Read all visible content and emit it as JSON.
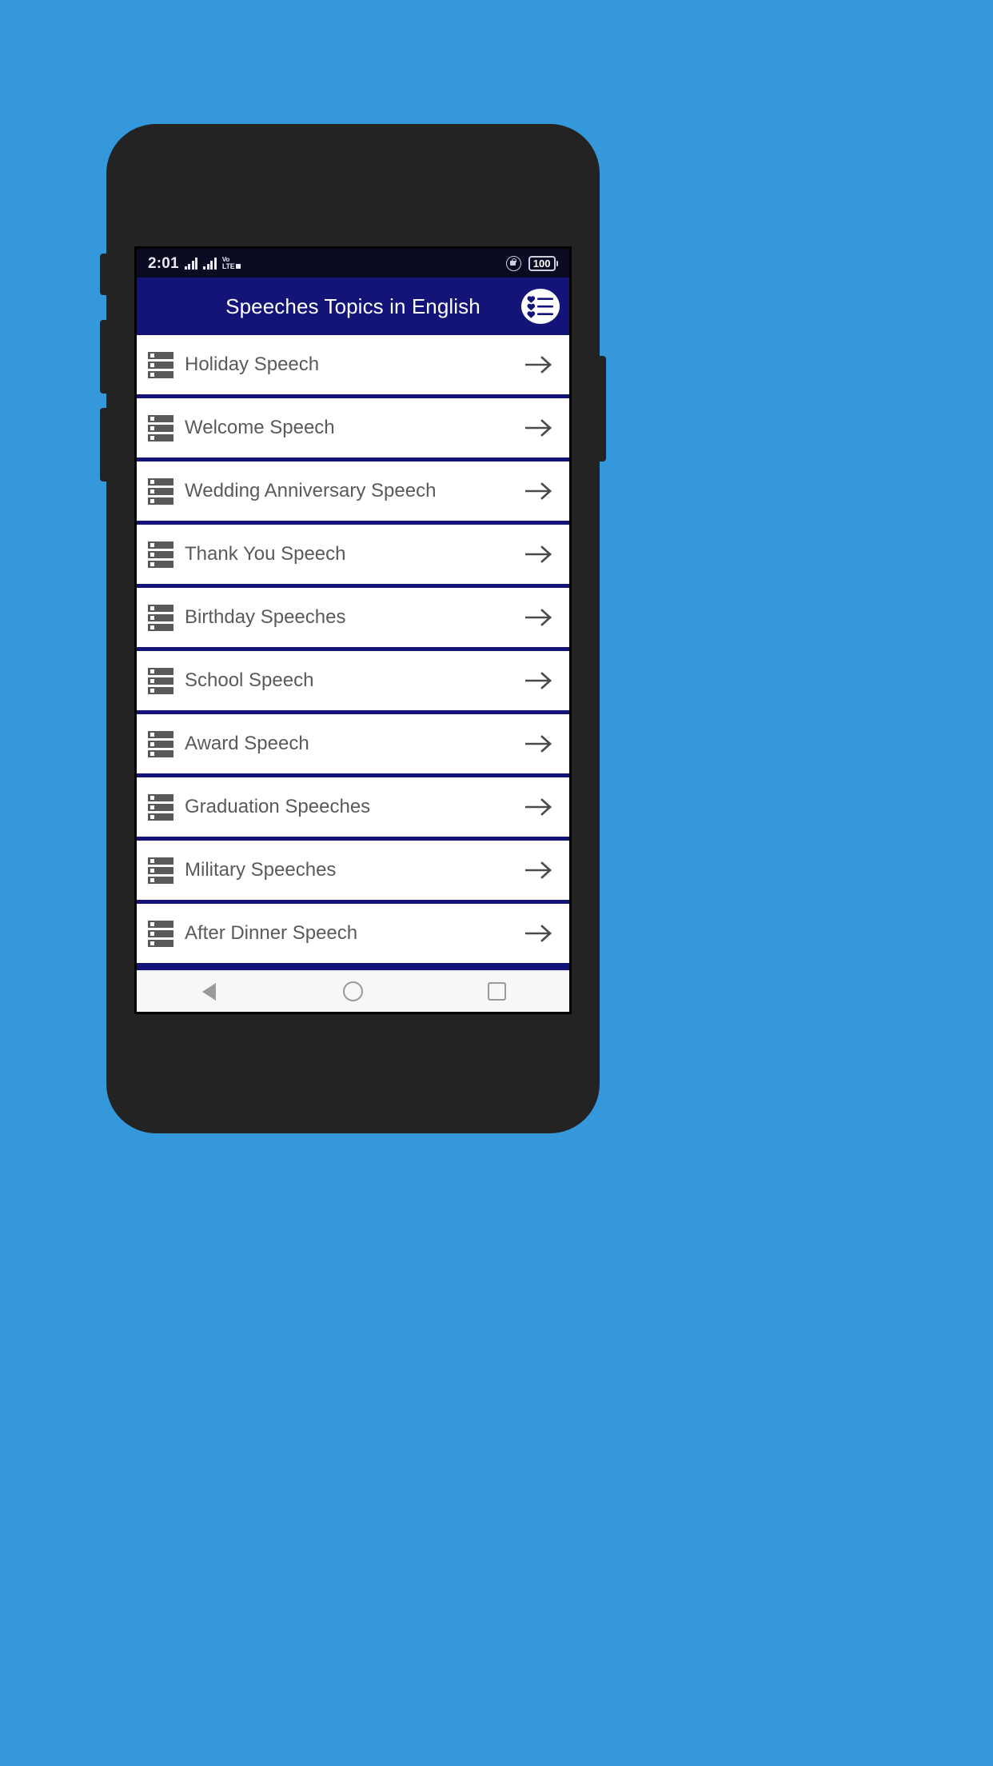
{
  "background_color": "#3498db",
  "device": {
    "frame_color": "#232323",
    "buttons": [
      "volume-up",
      "volume-down",
      "power",
      "side-button-right"
    ]
  },
  "status_bar": {
    "time": "2:01",
    "network_label_top": "Vo",
    "network_label_bottom": "LTE",
    "signal_icon": "signal-bars-icon",
    "rotation_lock_icon": "rotation-lock-icon",
    "battery_level": "100",
    "background_color": "#0a0a22"
  },
  "app_bar": {
    "title": "Speeches Topics in English",
    "background_color": "#141478",
    "action_icon": "favorites-list-icon"
  },
  "list": {
    "divider_color": "#141478",
    "row_icon": "list-bars-icon",
    "row_arrow_icon": "arrow-right-icon",
    "items": [
      {
        "label": "Holiday Speech"
      },
      {
        "label": "Welcome Speech"
      },
      {
        "label": "Wedding Anniversary Speech"
      },
      {
        "label": "Thank You Speech"
      },
      {
        "label": "Birthday Speeches"
      },
      {
        "label": "School Speech"
      },
      {
        "label": "Award Speech"
      },
      {
        "label": "Graduation Speeches"
      },
      {
        "label": "Military Speeches"
      },
      {
        "label": "After Dinner Speech"
      }
    ]
  },
  "nav_bar": {
    "back_icon": "back-triangle-icon",
    "home_icon": "home-circle-icon",
    "recents_icon": "recents-square-icon",
    "background_color": "#f7f7f7"
  }
}
